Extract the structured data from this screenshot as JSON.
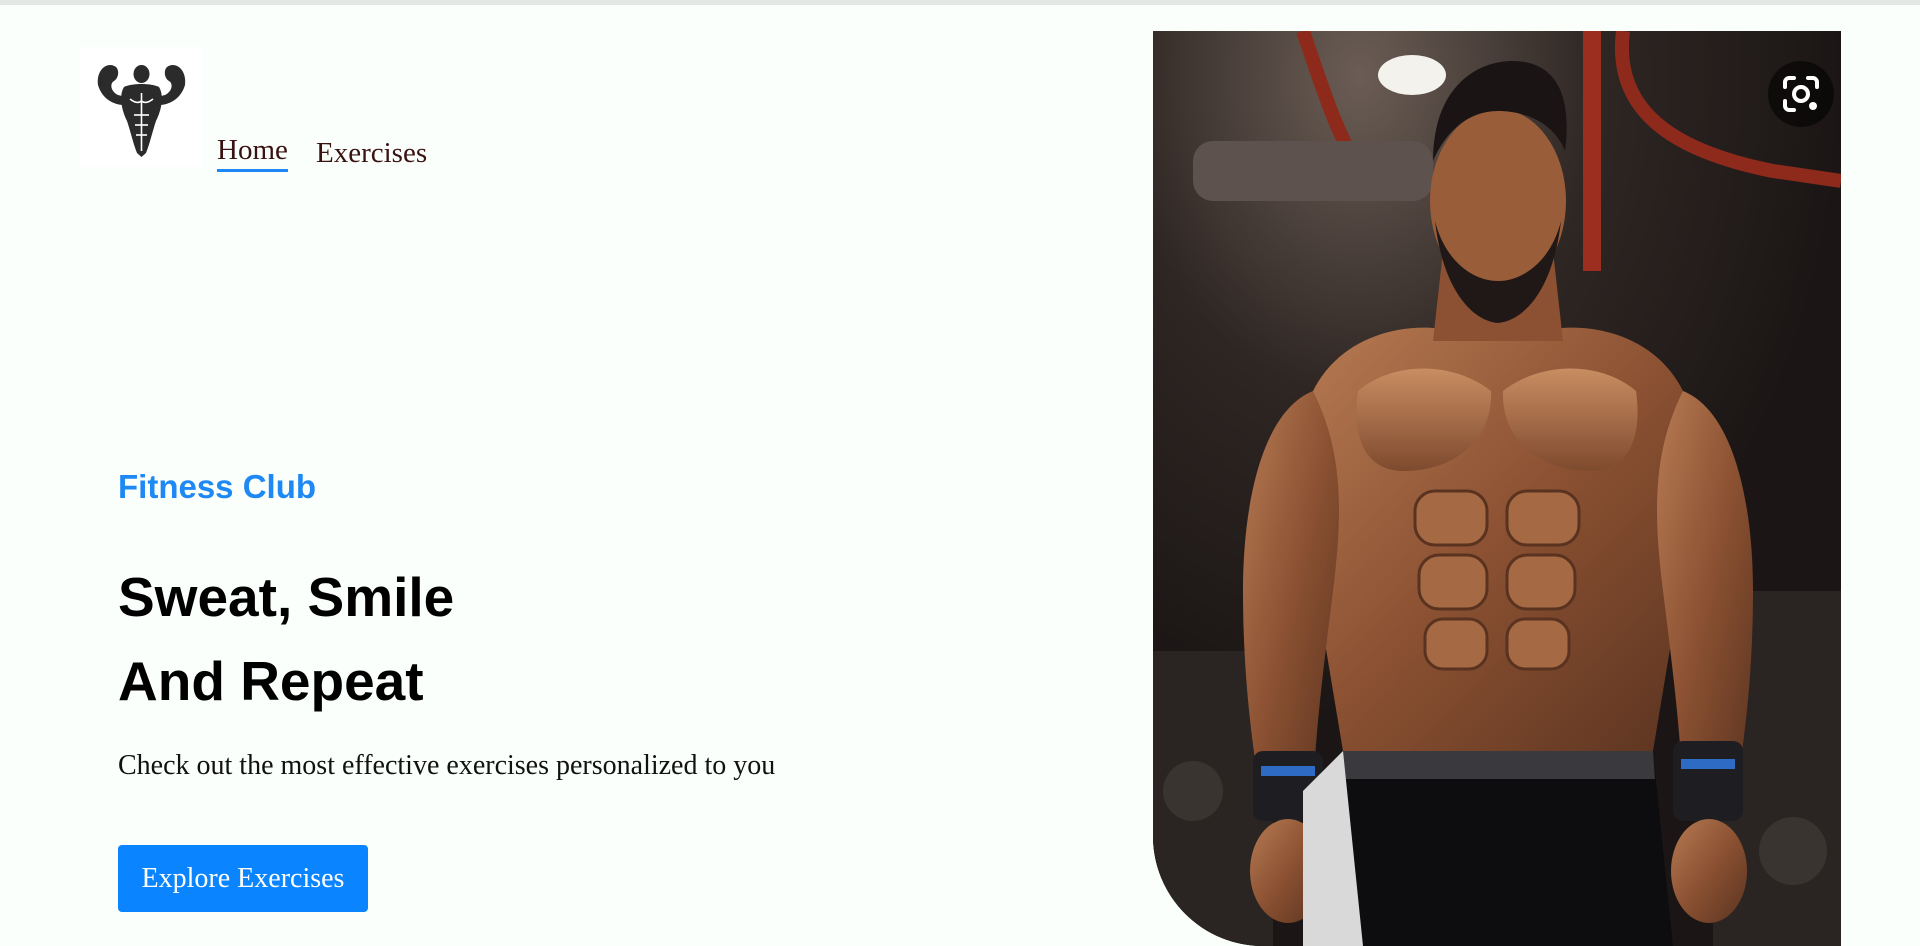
{
  "header": {
    "logo_icon": "bodybuilder-logo-icon",
    "nav": {
      "home_label": "Home",
      "exercises_label": "Exercises"
    }
  },
  "hero": {
    "eyebrow": "Fitness Club",
    "title_line1": "Sweat, Smile",
    "title_line2": "And Repeat",
    "subtitle": "Check out the most effective exercises personalized to you",
    "cta_label": "Explore Exercises",
    "image_icon": "bodybuilder-photo",
    "lens_icon": "visual-search-icon"
  },
  "colors": {
    "background": "#fafffb",
    "accent": "#1e88f5",
    "button": "#0a84ff",
    "nav_underline": "#ff2625"
  }
}
